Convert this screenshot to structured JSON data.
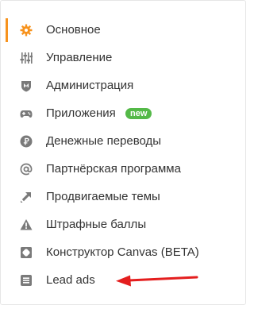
{
  "colors": {
    "accent": "#f7931e",
    "icon": "#7a7a7a",
    "badge": "#54b948",
    "arrow": "#e41e1e"
  },
  "menu": {
    "items": [
      {
        "label": "Основное",
        "icon": "gear-icon",
        "active": true
      },
      {
        "label": "Управление",
        "icon": "sliders-icon"
      },
      {
        "label": "Администрация",
        "icon": "shield-icon"
      },
      {
        "label": "Приложения",
        "icon": "gamepad-icon",
        "badge": "new"
      },
      {
        "label": "Денежные переводы",
        "icon": "ruble-icon"
      },
      {
        "label": "Партнёрская программа",
        "icon": "at-icon"
      },
      {
        "label": "Продвигаемые темы",
        "icon": "promote-arrow-icon"
      },
      {
        "label": "Штрафные баллы",
        "icon": "warning-icon"
      },
      {
        "label": "Конструктор Canvas (BETA)",
        "icon": "canvas-icon"
      },
      {
        "label": "Lead ads",
        "icon": "list-icon"
      }
    ]
  }
}
